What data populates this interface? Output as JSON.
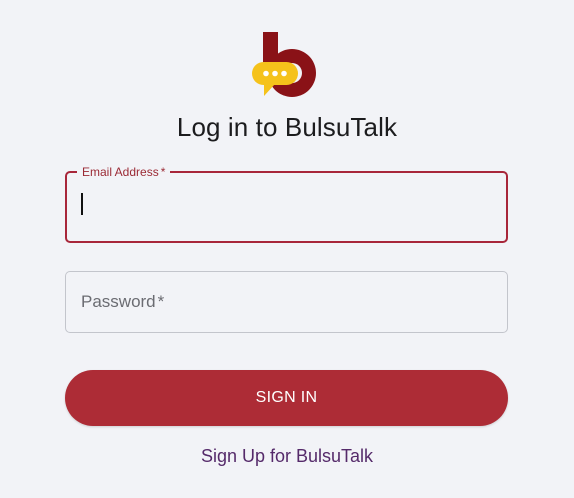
{
  "app": {
    "title": "Log in to BulsuTalk"
  },
  "colors": {
    "brand_maroon": "#8a1217",
    "bubble_yellow": "#f5c21b",
    "accent_red": "#ad2c36",
    "link_purple": "#552a6a",
    "background": "#f2f3f7"
  },
  "logo": {
    "icon": "bulsutalk-logo-icon"
  },
  "form": {
    "email": {
      "label": "Email Address",
      "required_mark": "*",
      "value": ""
    },
    "password": {
      "label": "Password",
      "required_mark": "*",
      "value": ""
    },
    "submit_label": "SIGN IN"
  },
  "signup": {
    "link_text": "Sign Up for BulsuTalk"
  }
}
